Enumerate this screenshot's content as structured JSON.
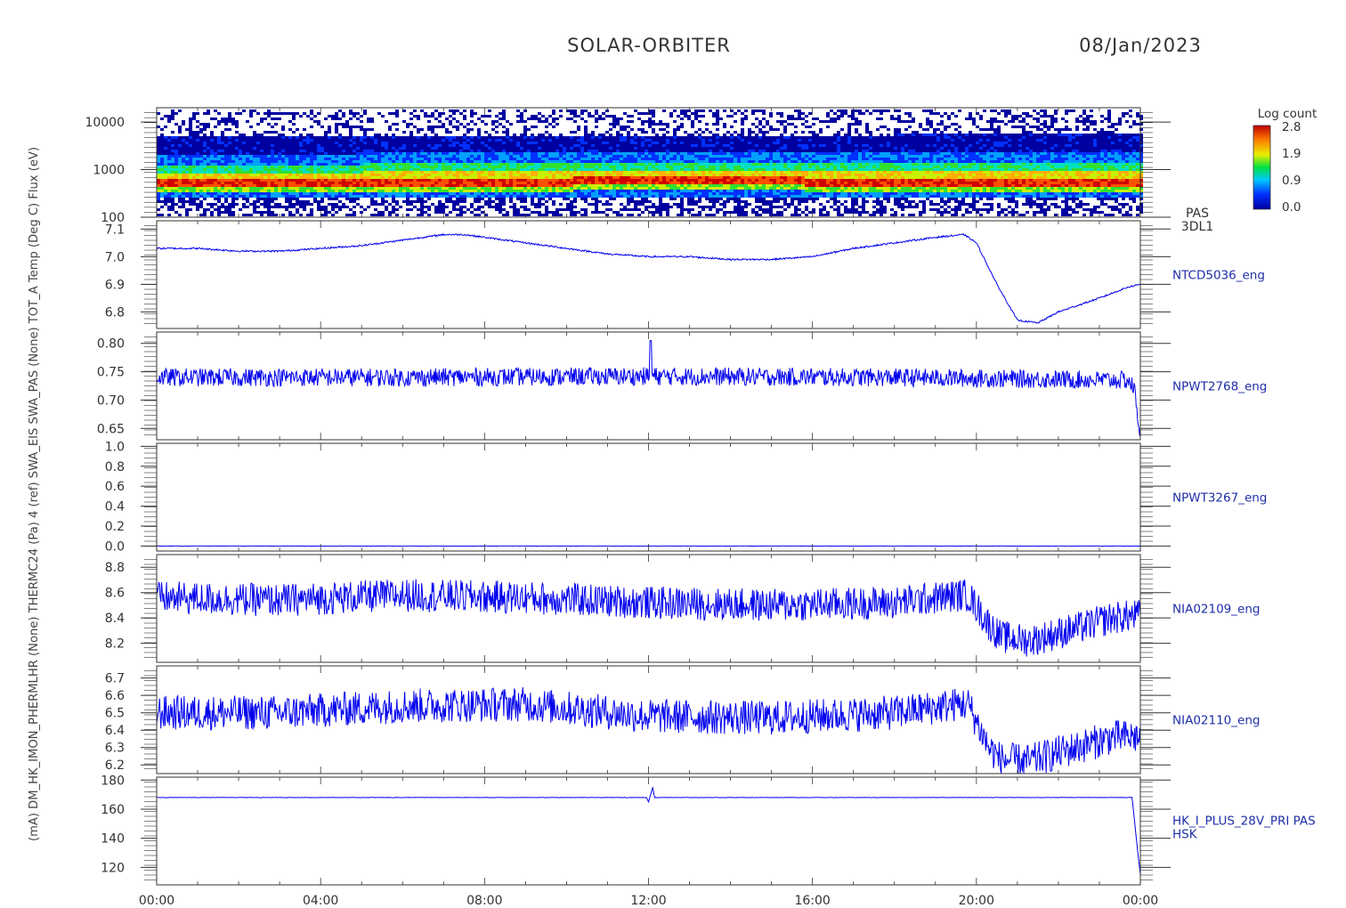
{
  "header": {
    "mission": "SOLAR-ORBITER",
    "date": "08/Jan/2023"
  },
  "x_axis": {
    "ticks": [
      "00:00",
      "04:00",
      "08:00",
      "12:00",
      "16:00",
      "20:00",
      "00:00"
    ],
    "range_hours": [
      0,
      24
    ]
  },
  "y_axis_label_overlap": "(mA) DM_HK_IMON_PHERMLHR (None) THERMC24 (Pa) 4 (ref) SWA_EIS SWA_PAS (None) TOT_A Temp (Deg C) Flux (eV)",
  "colorbar": {
    "title": "Log count",
    "ticks": [
      "2.8",
      "1.9",
      "0.9",
      "0.0"
    ],
    "range": [
      0.0,
      2.8
    ]
  },
  "colors": {
    "trace": "#0000ee",
    "frame": "#333333",
    "label": "#1f2fa8"
  },
  "chart_data": [
    {
      "type": "heatmap",
      "panel": "spectrogram",
      "side_label": [
        "PAS",
        "3DL1"
      ],
      "yscale": "log",
      "ylim": [
        100,
        20000
      ],
      "ytick_labels": [
        "10000",
        "1000",
        "100"
      ],
      "ytick_values": [
        10000,
        1000,
        100
      ],
      "z_label": "Log count",
      "zlim": [
        0.0,
        2.8
      ],
      "peak_band_eV": [
        [
          0,
          560
        ],
        [
          4,
          580
        ],
        [
          8,
          600
        ],
        [
          12,
          620
        ],
        [
          16,
          610
        ],
        [
          20,
          600
        ],
        [
          24,
          590
        ]
      ]
    },
    {
      "type": "line",
      "panel": "NTCD5036_eng",
      "side_label": [
        "NTCD5036_eng"
      ],
      "ylim": [
        6.74,
        7.13
      ],
      "ytick_labels": [
        "7.1",
        "7.0",
        "6.9",
        "6.8"
      ],
      "ytick_values": [
        7.1,
        7.0,
        6.9,
        6.8
      ],
      "noise": 0.003,
      "x": [
        0,
        1,
        2,
        3,
        4,
        5,
        6,
        7,
        7.5,
        8,
        9,
        10,
        11,
        12,
        13,
        14,
        15,
        16,
        17,
        18,
        19,
        19.7,
        20,
        20.5,
        21,
        21.5,
        22,
        23,
        23.7,
        24
      ],
      "y": [
        7.03,
        7.03,
        7.02,
        7.02,
        7.03,
        7.04,
        7.06,
        7.08,
        7.08,
        7.07,
        7.05,
        7.03,
        7.01,
        7.0,
        7.0,
        6.99,
        6.99,
        7.0,
        7.03,
        7.05,
        7.07,
        7.08,
        7.05,
        6.9,
        6.77,
        6.76,
        6.8,
        6.85,
        6.89,
        6.9
      ]
    },
    {
      "type": "line",
      "panel": "NPWT2768_eng",
      "side_label": [
        "NPWT2768_eng"
      ],
      "ylim": [
        0.63,
        0.82
      ],
      "ytick_labels": [
        "0.80",
        "0.75",
        "0.70",
        "0.65"
      ],
      "ytick_values": [
        0.8,
        0.75,
        0.7,
        0.65
      ],
      "noise": 0.016,
      "x": [
        0,
        6,
        12,
        18,
        23.7,
        23.85,
        24
      ],
      "y": [
        0.74,
        0.74,
        0.742,
        0.74,
        0.735,
        0.72,
        0.64
      ],
      "spike": {
        "x": 12.05,
        "y": 0.805
      }
    },
    {
      "type": "line",
      "panel": "NPWT3267_eng",
      "side_label": [
        "NPWT3267_eng"
      ],
      "ylim": [
        -0.05,
        1.03
      ],
      "ytick_labels": [
        "1.0",
        "0.8",
        "0.6",
        "0.4",
        "0.2",
        "0.0"
      ],
      "ytick_values": [
        1.0,
        0.8,
        0.6,
        0.4,
        0.2,
        0.0
      ],
      "noise": 0.002,
      "x": [
        0,
        24
      ],
      "y": [
        0.0,
        0.0
      ]
    },
    {
      "type": "line",
      "panel": "NIA02109_eng",
      "side_label": [
        "NIA02109_eng"
      ],
      "ylim": [
        8.05,
        8.9
      ],
      "ytick_labels": [
        "8.8",
        "8.6",
        "8.4",
        "8.2"
      ],
      "ytick_values": [
        8.8,
        8.6,
        8.4,
        8.2
      ],
      "noise": 0.13,
      "x": [
        0,
        3,
        6,
        9,
        12,
        15,
        18,
        19.6,
        19.8,
        20.3,
        20.6,
        21.3,
        22,
        22.6,
        23.3,
        24
      ],
      "y": [
        8.56,
        8.54,
        8.58,
        8.56,
        8.52,
        8.5,
        8.52,
        8.58,
        8.58,
        8.35,
        8.25,
        8.22,
        8.28,
        8.33,
        8.4,
        8.42
      ]
    },
    {
      "type": "line",
      "panel": "NIA02110_eng",
      "side_label": [
        "NIA02110_eng"
      ],
      "ylim": [
        6.15,
        6.77
      ],
      "ytick_labels": [
        "6.7",
        "6.6",
        "6.5",
        "6.4",
        "6.3",
        "6.2"
      ],
      "ytick_values": [
        6.7,
        6.6,
        6.5,
        6.4,
        6.3,
        6.2
      ],
      "noise": 0.1,
      "x": [
        0,
        3,
        6,
        9,
        12,
        15,
        18,
        19.6,
        19.8,
        20.3,
        20.6,
        21.3,
        22,
        22.6,
        23.3,
        24
      ],
      "y": [
        6.5,
        6.5,
        6.54,
        6.55,
        6.48,
        6.47,
        6.5,
        6.55,
        6.55,
        6.3,
        6.23,
        6.22,
        6.27,
        6.31,
        6.36,
        6.36
      ]
    },
    {
      "type": "line",
      "panel": "HK_I_PLUS_28V_PRI PAS HSK",
      "side_label": [
        "HK_I_PLUS_28V_PRI PAS",
        "HSK"
      ],
      "ylim": [
        108,
        182
      ],
      "ytick_labels": [
        "180",
        "160",
        "140",
        "120"
      ],
      "ytick_values": [
        180,
        160,
        140,
        120
      ],
      "noise": 0.15,
      "x": [
        0,
        11.95,
        12.0,
        12.1,
        12.15,
        23.8,
        23.9,
        24
      ],
      "y": [
        168,
        168,
        165,
        175,
        168,
        168,
        140,
        115
      ]
    }
  ]
}
